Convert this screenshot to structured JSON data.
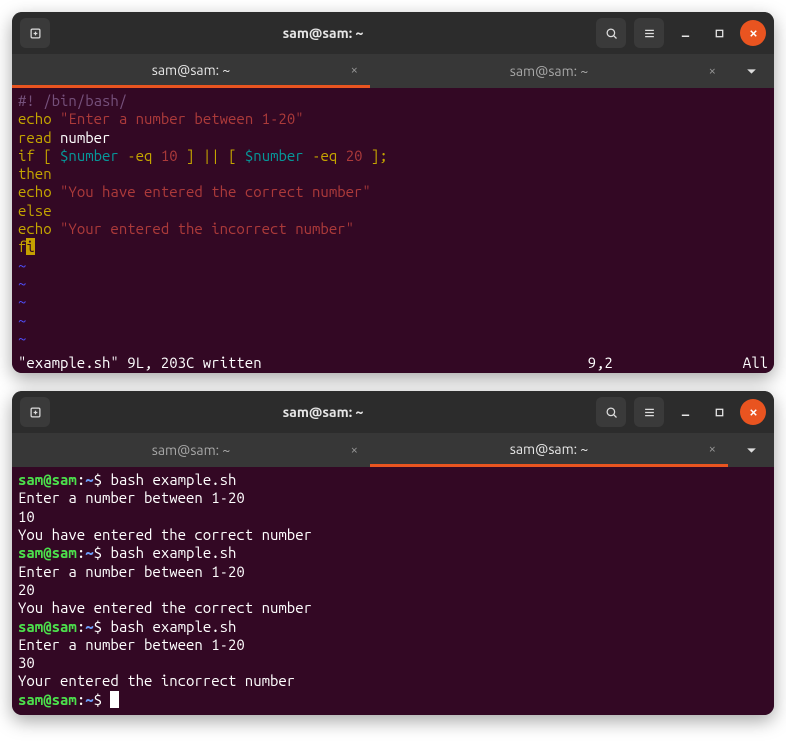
{
  "title": "sam@sam: ~",
  "tabs": {
    "t1": "sam@sam: ~",
    "t2": "sam@sam: ~"
  },
  "src": {
    "l1_comment": "#! /bin/bash/",
    "l2_kw": "echo ",
    "l2_str": "\"Enter a number between 1-20\"",
    "l3_kw": "read ",
    "l3_var": "number",
    "l4_kw": "if ",
    "l4_b1": "[ ",
    "l4_v1": "$number",
    "l4_op1": " -eq ",
    "l4_n1": "10",
    "l4_b2": " ]",
    "l4_or": " || ",
    "l4_b3": "[ ",
    "l4_v2": "$number",
    "l4_op2": " -eq ",
    "l4_n2": "20",
    "l4_b4": " ];",
    "l5": "then",
    "l6_kw": "echo ",
    "l6_str": "\"You have entered the correct number\"",
    "l7": "else",
    "l8_kw": "echo ",
    "l8_str": "\"Your entered the incorrect number\"",
    "l9_a": "f",
    "l9_b": "i",
    "tilde": "~"
  },
  "status": {
    "left": "\"example.sh\" 9L, 203C written",
    "pos": "9,2",
    "pct": "All"
  },
  "prompt": {
    "userhost": "sam@sam",
    "colon": ":",
    "path": "~",
    "dollar": "$ "
  },
  "run": {
    "cmd": "bash example.sh",
    "ask": "Enter a number between 1-20",
    "in1": "10",
    "out1": "You have entered the correct number",
    "in2": "20",
    "out2": "You have entered the correct number",
    "in3": "30",
    "out3": "Your entered the incorrect number"
  }
}
